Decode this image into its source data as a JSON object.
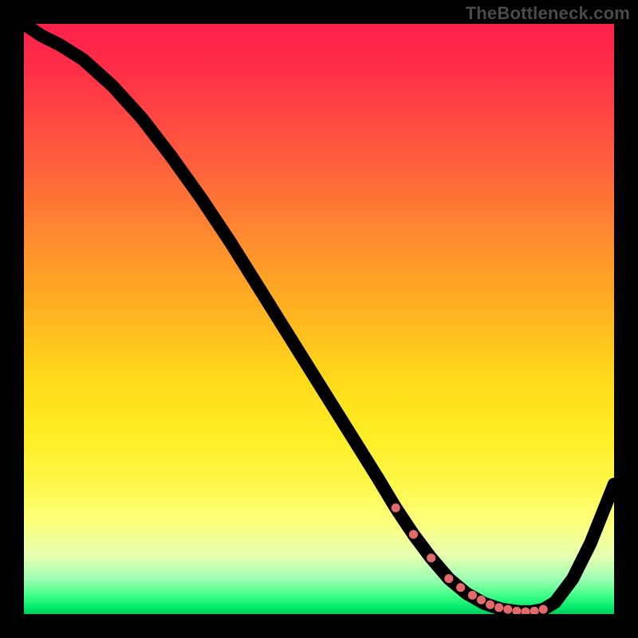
{
  "watermark": "TheBottleneck.com",
  "chart_data": {
    "type": "line",
    "title": "",
    "xlabel": "",
    "ylabel": "",
    "xlim": [
      0,
      100
    ],
    "ylim": [
      0,
      100
    ],
    "grid": false,
    "legend": false,
    "background": "thermal-gradient",
    "series": [
      {
        "name": "bottleneck-curve",
        "x": [
          0,
          3,
          6,
          10,
          15,
          20,
          25,
          30,
          35,
          40,
          45,
          50,
          55,
          60,
          63,
          66,
          69,
          72,
          75,
          78,
          81,
          84,
          86,
          88,
          90,
          93,
          96,
          100
        ],
        "y": [
          100,
          98,
          96.5,
          94,
          89.5,
          84,
          77.5,
          70.5,
          63,
          55,
          47,
          39,
          31,
          23,
          18,
          13.5,
          9.5,
          6,
          3.5,
          1.8,
          0.8,
          0.4,
          0.4,
          0.8,
          2,
          6,
          12,
          22
        ]
      }
    ],
    "markers": {
      "name": "optimal-zone",
      "color": "#e26a6a",
      "points_x": [
        63,
        66,
        69,
        72,
        74,
        76,
        77.5,
        79,
        80.5,
        82,
        83.5,
        85,
        86.5,
        88
      ],
      "points_y": [
        18,
        13.5,
        9.5,
        6,
        4.5,
        3.2,
        2.4,
        1.6,
        1.1,
        0.8,
        0.5,
        0.4,
        0.5,
        0.8
      ]
    }
  }
}
